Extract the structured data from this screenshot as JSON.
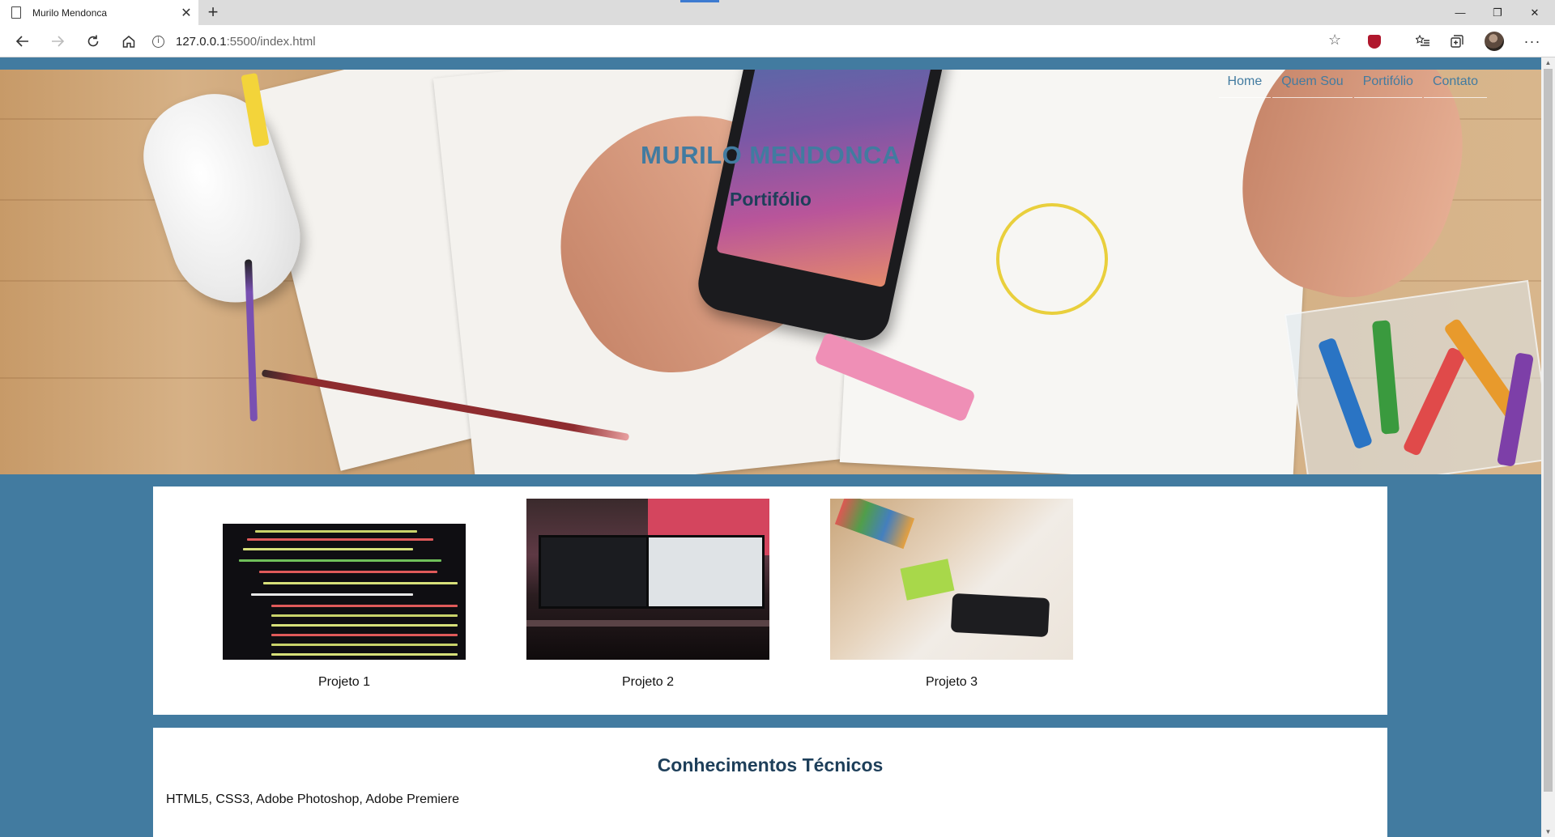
{
  "browser": {
    "tab_title": "Murilo Mendonca",
    "tab_close": "✕",
    "new_tab": "+",
    "url_host": "127.0.0.1",
    "url_rest": ":5500/index.html",
    "controls": {
      "minimize": "—",
      "restore": "❐",
      "close": "✕"
    },
    "icons": [
      "back-icon",
      "forward-icon",
      "refresh-icon",
      "home-icon",
      "info-icon",
      "star-icon",
      "shield-extension-icon",
      "favorites-icon",
      "collections-icon",
      "profile-avatar",
      "more-icon"
    ]
  },
  "nav": {
    "items": [
      {
        "label": "Home"
      },
      {
        "label": "Quem Sou"
      },
      {
        "label": "Portifólio"
      },
      {
        "label": "Contato"
      }
    ]
  },
  "hero": {
    "title": "MURILO MENDONCA",
    "subtitle": "Portifólio"
  },
  "projects": [
    {
      "label": "Projeto 1"
    },
    {
      "label": "Projeto 2"
    },
    {
      "label": "Projeto 3"
    }
  ],
  "skills": {
    "heading": "Conhecimentos Técnicos",
    "text": "HTML5, CSS3, Adobe Photoshop, Adobe Premiere"
  },
  "colors": {
    "page_background": "#427ba0",
    "title_blue": "#427ba0",
    "heading_dark": "#1e3f5a"
  }
}
